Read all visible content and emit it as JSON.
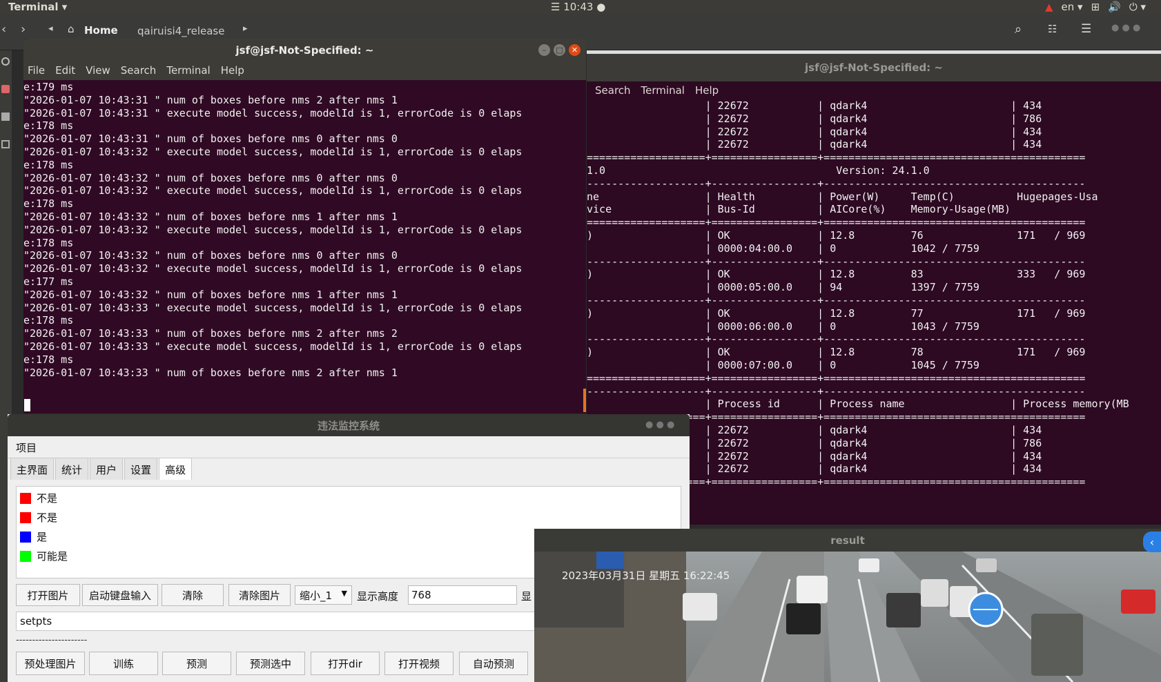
{
  "topbar": {
    "app_label": "Terminal ▾",
    "clock": "☰ 10:43 ●",
    "tray_lang": "en ▾",
    "tray_icons": [
      "▲",
      "⊞",
      "🔊",
      "⏻ ▾"
    ]
  },
  "nautilus": {
    "home_label": "Home",
    "folder_label": "qairuisi4_release",
    "icons": [
      "search-icon",
      "grid-icon",
      "menu-icon"
    ]
  },
  "terminal_back": {
    "title": "jsf@jsf-Not-Specified: ~",
    "menu": [
      "Search",
      "Terminal",
      "Help"
    ],
    "lines": [
      "                   | 22672           | qdark4                       | 434",
      "                   | 22672           | qdark4                       | 786",
      "                   | 22672           | qdark4                       | 434",
      "                   | 22672           | qdark4                       | 434",
      "===================+=================+==========================================",
      "1.0                                     Version: 24.1.0",
      "-------------------+-----------------+------------------------------------------",
      "ne                 | Health          | Power(W)     Temp(C)          Hugepages-Usa",
      "vice               | Bus-Id          | AICore(%)    Memory-Usage(MB)",
      "===================+=================+==========================================",
      ")                  | OK              | 12.8         76               171   / 969",
      "                   | 0000:04:00.0    | 0            1042 / 7759",
      "-------------------+-----------------+------------------------------------------",
      ")                  | OK              | 12.8         83               333   / 969",
      "                   | 0000:05:00.0    | 94           1397 / 7759",
      "-------------------+-----------------+------------------------------------------",
      ")                  | OK              | 12.8         77               171   / 969",
      "                   | 0000:06:00.0    | 0            1043 / 7759",
      "-------------------+-----------------+------------------------------------------",
      ")                  | OK              | 12.8         78               171   / 969",
      "                   | 0000:07:00.0    | 0            1045 / 7759",
      "===================+=================+==========================================",
      "-------------------+-----------------+------------------------------------------",
      "                   | Process id      | Process name                 | Process memory(MB",
      "===================+=================+==========================================",
      "                   | 22672           | qdark4                       | 434",
      "                   | 22672           | qdark4                       | 786",
      "                   | 22672           | qdark4                       | 434",
      "                   | 22672           | qdark4                       | 434",
      "===================+=================+=========================================="
    ]
  },
  "terminal_front": {
    "title": "jsf@jsf-Not-Specified: ~",
    "menu": [
      "File",
      "Edit",
      "View",
      "Search",
      "Terminal",
      "Help"
    ],
    "lines": [
      "e:179 ms",
      "\"2026-01-07 10:43:31 \" num of boxes before nms 2 after nms 1",
      "\"2026-01-07 10:43:31 \" execute model success, modelId is 1, errorCode is 0 elaps",
      "e:178 ms",
      "\"2026-01-07 10:43:31 \" num of boxes before nms 0 after nms 0",
      "\"2026-01-07 10:43:32 \" execute model success, modelId is 1, errorCode is 0 elaps",
      "e:178 ms",
      "\"2026-01-07 10:43:32 \" num of boxes before nms 0 after nms 0",
      "\"2026-01-07 10:43:32 \" execute model success, modelId is 1, errorCode is 0 elaps",
      "e:178 ms",
      "\"2026-01-07 10:43:32 \" num of boxes before nms 1 after nms 1",
      "\"2026-01-07 10:43:32 \" execute model success, modelId is 1, errorCode is 0 elaps",
      "e:178 ms",
      "\"2026-01-07 10:43:32 \" num of boxes before nms 0 after nms 0",
      "\"2026-01-07 10:43:32 \" execute model success, modelId is 1, errorCode is 0 elaps",
      "e:177 ms",
      "\"2026-01-07 10:43:32 \" num of boxes before nms 1 after nms 1",
      "\"2026-01-07 10:43:33 \" execute model success, modelId is 1, errorCode is 0 elaps",
      "e:178 ms",
      "\"2026-01-07 10:43:33 \" num of boxes before nms 2 after nms 2",
      "\"2026-01-07 10:43:33 \" execute model success, modelId is 1, errorCode is 0 elaps",
      "e:178 ms",
      "\"2026-01-07 10:43:33 \" num of boxes before nms 2 after nms 1"
    ]
  },
  "app": {
    "title": "违法监控系统",
    "menu_label": "项目",
    "tabs": [
      "主界面",
      "统计",
      "用户",
      "设置",
      "高级"
    ],
    "legend": [
      {
        "label": "不是",
        "color": "#ff0000"
      },
      {
        "label": "不是",
        "color": "#ff0000"
      },
      {
        "label": "是",
        "color": "#0000ff"
      },
      {
        "label": "可能是",
        "color": "#00ff00"
      }
    ],
    "row1": {
      "open_image": "打开图片",
      "keyboard_input": "启动键盘输入",
      "clear": "清除",
      "clear_image": "清除图片",
      "scale_select": "缩小_1",
      "height_label": "显示高度",
      "height_value": "768",
      "more_label": "显"
    },
    "setpts": "setpts",
    "separator": "----------------------",
    "row2": [
      "预处理图片",
      "训练",
      "预测",
      "预测选中",
      "打开dir",
      "打开视频",
      "自动预测"
    ]
  },
  "result": {
    "title": "result",
    "timestamp": "2023年03月31日 星期五 16:22:45"
  }
}
